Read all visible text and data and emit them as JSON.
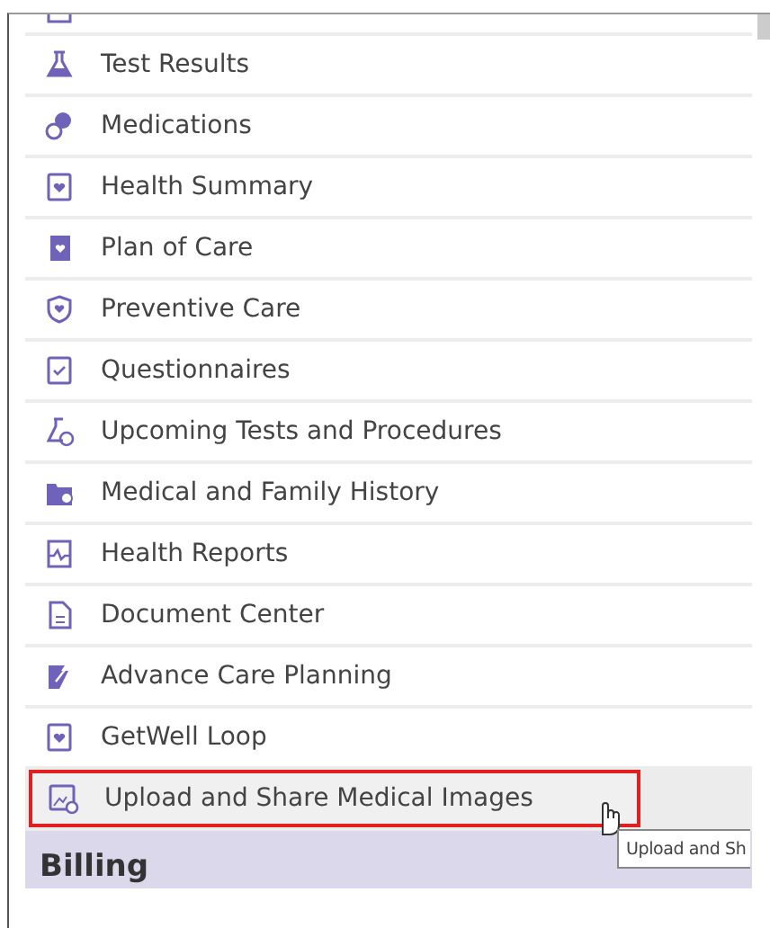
{
  "menu": {
    "items": [
      {
        "label": "Test Results",
        "hovered": false
      },
      {
        "label": "Medications",
        "hovered": false
      },
      {
        "label": "Health Summary",
        "hovered": false
      },
      {
        "label": "Plan of Care",
        "hovered": false
      },
      {
        "label": "Preventive Care",
        "hovered": false
      },
      {
        "label": "Questionnaires",
        "hovered": false
      },
      {
        "label": "Upcoming Tests and Procedures",
        "hovered": false
      },
      {
        "label": "Medical and Family History",
        "hovered": false
      },
      {
        "label": "Health Reports",
        "hovered": false
      },
      {
        "label": "Document Center",
        "hovered": false
      },
      {
        "label": "Advance Care Planning",
        "hovered": false
      },
      {
        "label": "GetWell Loop",
        "hovered": false
      },
      {
        "label": "Upload and Share Medical Images",
        "hovered": true
      }
    ]
  },
  "section": {
    "title": "Billing"
  },
  "tooltip": {
    "text": "Upload and Sh"
  }
}
